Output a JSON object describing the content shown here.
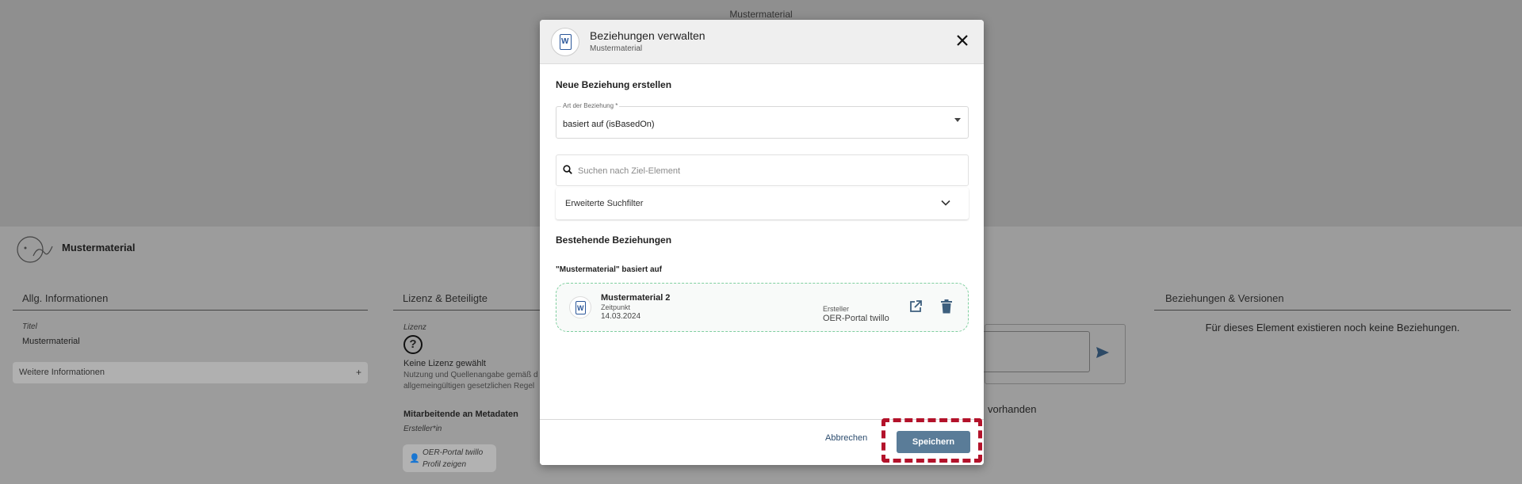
{
  "background": {
    "top_title": "Mustermaterial",
    "element_name": "Mustermaterial",
    "general": {
      "heading": "Allg. Informationen",
      "title_label": "Titel",
      "title_value": "Mustermaterial",
      "more_info": "Weitere Informationen",
      "more_info_icon": "+"
    },
    "license": {
      "heading": "Lizenz & Beteiligte",
      "license_label": "Lizenz",
      "license_icon": "?",
      "no_license": "Keine Lizenz gewählt",
      "desc_line1": "Nutzung und Quellenangabe gemäß d",
      "desc_line2": "allgemeingültigen gesetzlichen Regel",
      "contributors_heading": "Mitarbeitende an Metadaten",
      "creator_label": "Ersteller*in",
      "creator_name": "OER-Portal twillo",
      "profile_link": "Profil zeigen"
    },
    "comments": {
      "none_text": "vorhanden"
    },
    "relations": {
      "heading": "Beziehungen & Versionen",
      "none_text": "Für dieses Element existieren noch keine Beziehungen."
    }
  },
  "dialog": {
    "title": "Beziehungen verwalten",
    "subtitle": "Mustermaterial",
    "icon_letter": "W",
    "new_section": "Neue Beziehung erstellen",
    "type_label": "Art der Beziehung *",
    "type_value": "basiert auf (isBasedOn)",
    "search_placeholder": "Suchen nach Ziel-Element",
    "filter_label": "Erweiterte Suchfilter",
    "existing_section": "Bestehende Beziehungen",
    "relation_group": "\"Mustermaterial\" basiert auf",
    "relation_item": {
      "name": "Mustermaterial 2",
      "time_label": "Zeitpunkt",
      "time_value": "14.03.2024",
      "creator_label": "Ersteller",
      "creator_value": "OER-Portal twillo"
    },
    "cancel_label": "Abbrechen",
    "save_label": "Speichern"
  },
  "colors": {
    "accent": "#5a7c98",
    "highlight": "#b3122a",
    "relation_border": "#7fcf9f"
  }
}
